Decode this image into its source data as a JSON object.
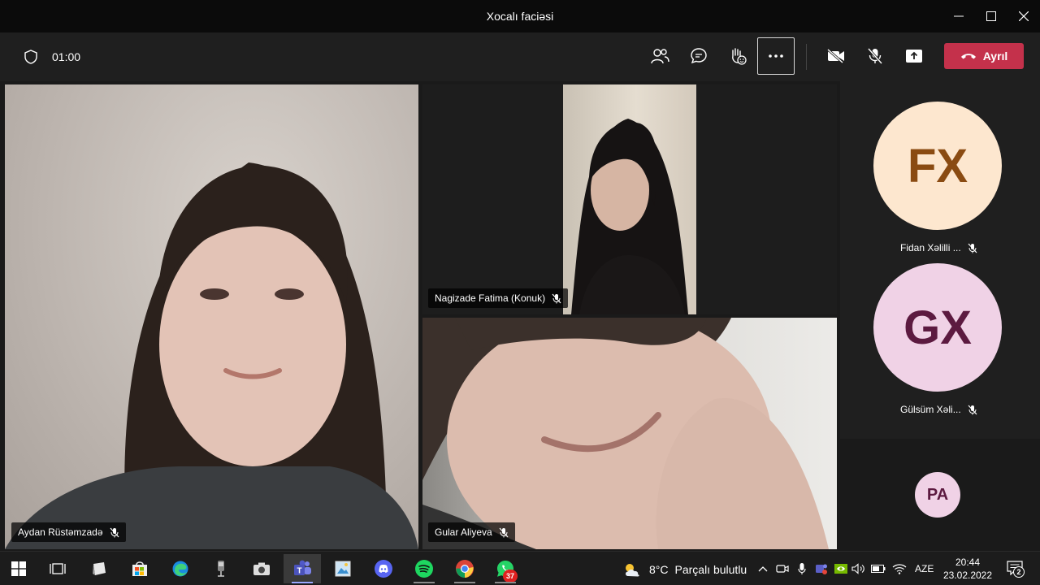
{
  "window": {
    "title": "Xocalı faciəsi"
  },
  "meeting": {
    "timer": "01:00",
    "leave_label": "Ayrıl"
  },
  "participants": {
    "aydan": {
      "name": "Aydan Rüstəmzadə"
    },
    "nagizade": {
      "name": "Nagizade Fatima (Konuk)"
    },
    "gular": {
      "name": "Gular Aliyeva"
    },
    "fidan": {
      "initials": "FX",
      "name": "Fidan Xəlilli ...",
      "bg": "#fde7cf",
      "fg": "#8a4b12"
    },
    "gulsum": {
      "initials": "GX",
      "name": "Gülsüm Xəli...",
      "bg": "#f0d2e6",
      "fg": "#5c1a40"
    },
    "pa": {
      "initials": "PA",
      "bg": "#f0d2e6",
      "fg": "#5c1a40"
    }
  },
  "taskbar": {
    "weather_temp": "8°C",
    "weather_desc": "Parçalı bulutlu",
    "language": "AZE",
    "time": "20:44",
    "date": "23.02.2022",
    "whatsapp_badge": "37",
    "notification_count": "2"
  },
  "colors": {
    "leave_red": "#c4314b",
    "teams_accent": "#6264a7"
  }
}
